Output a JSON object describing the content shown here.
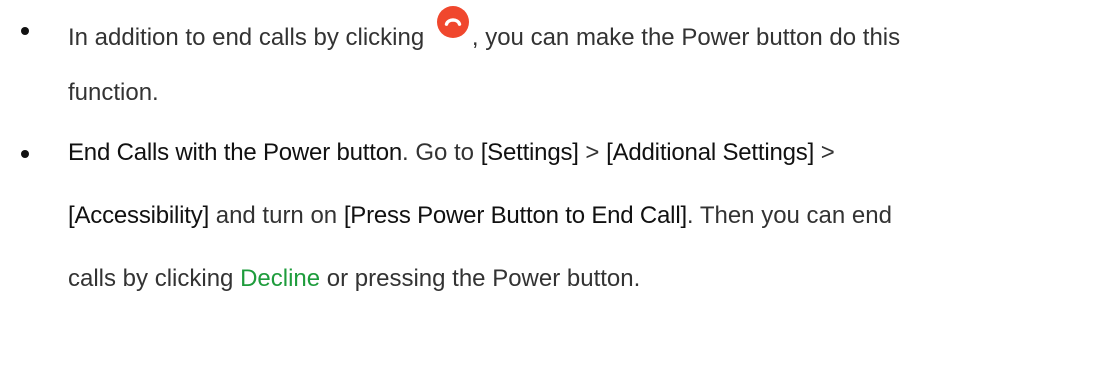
{
  "bullets": [
    {
      "line1": {
        "before": "In addition to end calls by clicking ",
        "icon": "end-call-icon",
        "after": ", you can make the Power button do this"
      },
      "line2": "function."
    },
    {
      "line1": {
        "term": "End Calls with the Power button",
        "t1": ". Go to ",
        "settings": "[Settings]",
        "t2": " > ",
        "additional": "[Additional Settings]",
        "t3": " >"
      },
      "line2": {
        "accessibility": "[Accessibility]",
        "t1": " and turn on ",
        "press_power": "[Press Power Button to End Call]",
        "t2": ". Then you can end"
      },
      "line3": {
        "before": "calls by clicking ",
        "decline": "Decline",
        "after": " or pressing the Power button."
      }
    }
  ],
  "colors": {
    "text": "#333333",
    "emphasis": "#111111",
    "link_green": "#1e9c3c",
    "end_call_red": "#f0472d"
  }
}
